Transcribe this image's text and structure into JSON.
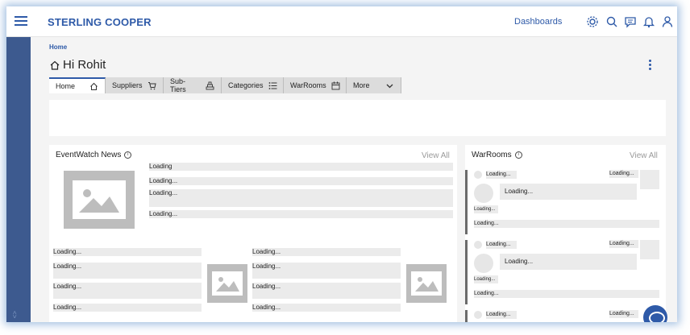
{
  "header": {
    "brand": "STERLING COOPER",
    "dashboards_label": "Dashboards",
    "icons": [
      "gear-icon",
      "search-icon",
      "chat-icon",
      "bell-icon",
      "user-icon"
    ]
  },
  "breadcrumb": "Home",
  "page_title": "Hi Rohit",
  "tabs": [
    {
      "label": "Home",
      "icon": "home-icon"
    },
    {
      "label": "Suppliers",
      "icon": "cart-icon"
    },
    {
      "label": "Sub-Tiers",
      "icon": "tier-icon"
    },
    {
      "label": "Categories",
      "icon": "list-icon"
    },
    {
      "label": "WarRooms",
      "icon": "calendar-icon"
    },
    {
      "label": "More",
      "icon": "chevron-down-icon"
    }
  ],
  "news": {
    "title": "EventWatch News",
    "view_all": "View All",
    "top_lines": [
      "Loading",
      "Loading...",
      "Loading...",
      "Loading..."
    ],
    "left_lines": [
      "Loading...",
      "Loading...",
      "Loading...",
      "Loading..."
    ],
    "right_lines": [
      "Loading...",
      "Loading...",
      "Loading...",
      "Loading..."
    ]
  },
  "warrooms": {
    "title": "WarRooms",
    "view_all": "View All",
    "cards": [
      {
        "tag": "Loading...",
        "tag2": "Loading...",
        "main": "Loading...",
        "small": "Loading...",
        "footer": "Loading..."
      },
      {
        "tag": "Loading...",
        "tag2": "Loading...",
        "main": "Loading...",
        "small": "Loading...",
        "footer": "Loading..."
      },
      {
        "tag": "Loading...",
        "tag2": "Loading..."
      }
    ]
  },
  "colors": {
    "accent": "#2e5aa8",
    "rail": "#3d5a8f",
    "skeleton": "#ebebeb"
  }
}
